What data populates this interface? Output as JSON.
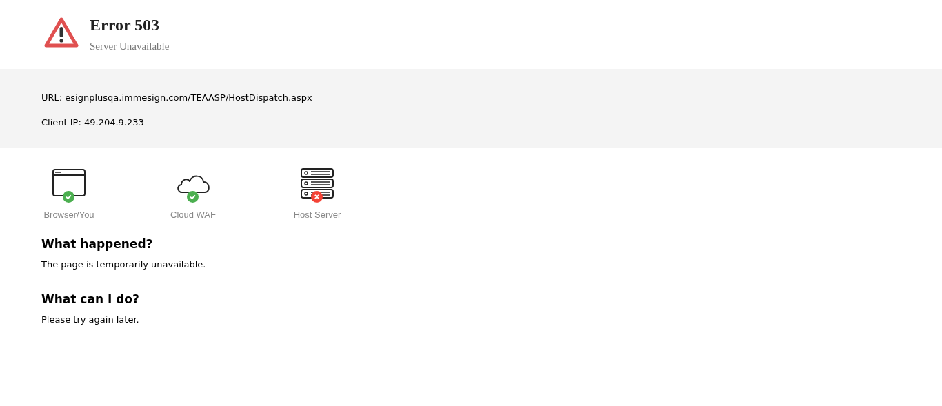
{
  "header": {
    "title": "Error 503",
    "subtitle": "Server Unavailable"
  },
  "info": [
    {
      "label": "URL:",
      "value": "esignplusqa.immesign.com/TEAASP/HostDispatch.aspx"
    },
    {
      "label": "Client IP:",
      "value": "49.204.9.233"
    }
  ],
  "path": [
    {
      "kind": "browser",
      "label": "Browser/You",
      "ok": true
    },
    {
      "kind": "cloud",
      "label": "Cloud WAF",
      "ok": true
    },
    {
      "kind": "server",
      "label": "Host Server",
      "ok": false
    }
  ],
  "sections": [
    {
      "heading": "What happened?",
      "text": "The page is temporarily unavailable."
    },
    {
      "heading": "What can I do?",
      "text": "Please try again later."
    }
  ]
}
